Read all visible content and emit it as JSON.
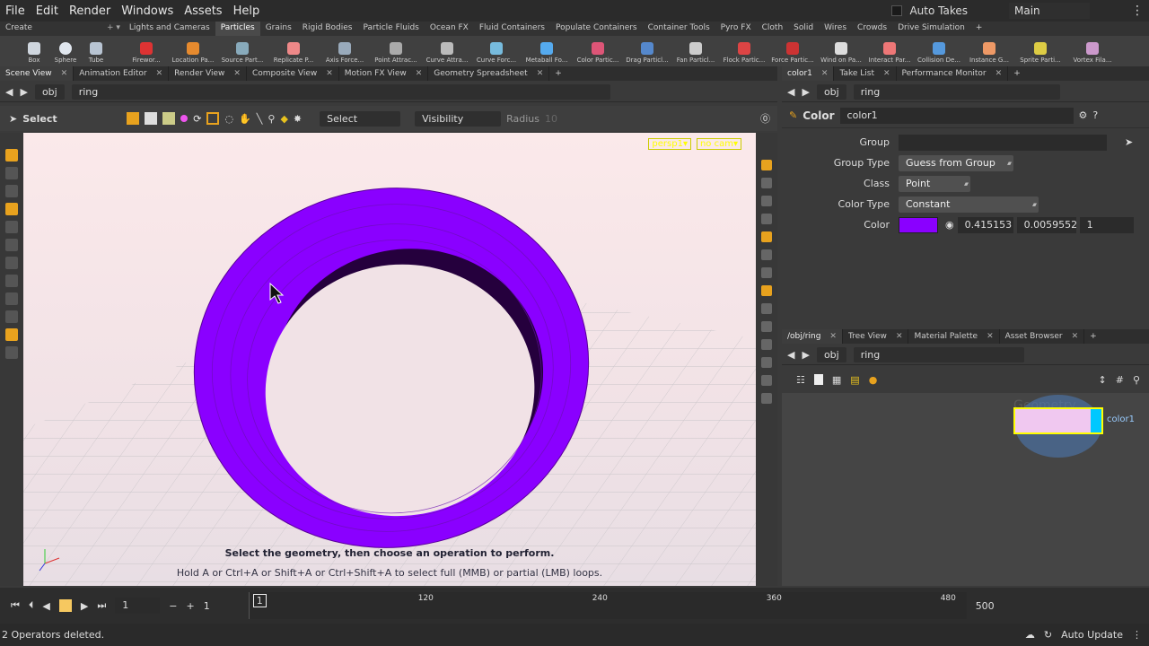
{
  "menubar": {
    "items": [
      "File",
      "Edit",
      "Render",
      "Windows",
      "Assets",
      "Help"
    ],
    "auto_takes": "Auto Takes",
    "desktop": "Main"
  },
  "shelf": {
    "create_tab": "Create",
    "tabs": [
      "Lights and Cameras",
      "Particles",
      "Grains",
      "Rigid Bodies",
      "Particle Fluids",
      "Ocean FX",
      "Fluid Containers",
      "Populate Containers",
      "Container Tools",
      "Pyro FX",
      "Cloth",
      "Solid",
      "Wires",
      "Crowds",
      "Drive Simulation"
    ],
    "create_tools": [
      "Box",
      "Sphere",
      "Tube"
    ],
    "tools": [
      "Firewor...",
      "Location Pa...",
      "Source Part...",
      "Replicate P...",
      "Axis Force...",
      "Point Attrac...",
      "Curve Attra...",
      "Curve Forc...",
      "Metaball Fo...",
      "Color Partic...",
      "Drag Particl...",
      "Fan Particl...",
      "Flock Partic...",
      "Force Partic...",
      "Wind on Pa...",
      "Interact Par...",
      "Collision De...",
      "Instance G...",
      "Sprite Parti...",
      "Vortex Fila..."
    ]
  },
  "left_pane": {
    "tabs": [
      "Scene View",
      "Animation Editor",
      "Render View",
      "Composite View",
      "Motion FX View",
      "Geometry Spreadsheet"
    ],
    "path": [
      "obj",
      "ring"
    ],
    "select_label": "Select",
    "select_dropdown": "Select",
    "visibility_dropdown": "Visibility",
    "radius_label": "Radius",
    "radius_value": "10",
    "viewport_badges": [
      "persp1▾",
      "no cam▾"
    ],
    "hint_bold": "Select the geometry, then choose an operation to perform.",
    "hint": "Hold A or Ctrl+A or Shift+A or Ctrl+Shift+A to select full (MMB) or partial (LMB) loops."
  },
  "param_pane": {
    "tabs": [
      "color1",
      "Take List",
      "Performance Monitor"
    ],
    "path": [
      "obj",
      "ring"
    ],
    "node_type": "Color",
    "node_name": "color1",
    "rows": {
      "group_label": "Group",
      "group_value": "",
      "group_type_label": "Group Type",
      "group_type_value": "Guess from Group",
      "class_label": "Class",
      "class_value": "Point",
      "color_type_label": "Color Type",
      "color_type_value": "Constant",
      "color_label": "Color",
      "color_r": "0.415153",
      "color_g": "0.00595527",
      "color_b": "1",
      "swatch": "#8a00ff"
    }
  },
  "network_pane": {
    "tabs": [
      "/obj/ring",
      "Tree View",
      "Material Palette",
      "Asset Browser"
    ],
    "path": [
      "obj",
      "ring"
    ],
    "watermark": "Geometry",
    "node_label": "color1"
  },
  "timeline": {
    "frame": "1",
    "start": "1",
    "marker": "1",
    "ticks": [
      "120",
      "240",
      "360",
      "480"
    ],
    "end": "500"
  },
  "status": {
    "message": "2 Operators deleted.",
    "update_mode": "Auto Update"
  }
}
